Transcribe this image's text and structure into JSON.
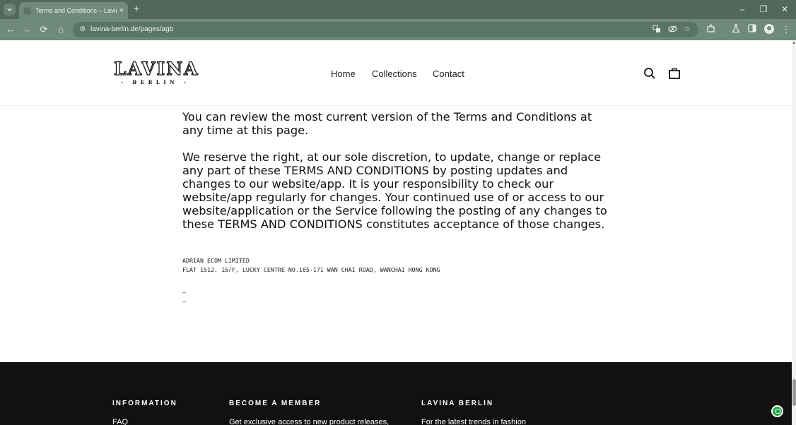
{
  "browser": {
    "tab_title": "Terms and Conditions – Lavina Berlin",
    "tab_close": "×",
    "new_tab": "+",
    "url": "lavina-berlin.de/pages/agb",
    "window_controls": {
      "minimize": "–",
      "restore": "❐",
      "close": "✕"
    },
    "toolbar_glyphs": {
      "back": "←",
      "forward": "→",
      "reload": "⟳",
      "home": "⌂",
      "site_info": "⚙",
      "bookmark": "☆",
      "menu": "⋮"
    }
  },
  "site": {
    "logo_main": "LAVINA",
    "logo_sub": "- BERLIN -",
    "nav": {
      "home": "Home",
      "collections": "Collections",
      "contact": "Contact"
    }
  },
  "content": {
    "paragraphs": [
      "You can review the most current version of the Terms and Conditions at any time at this page.",
      "We reserve the right, at our sole discretion, to update, change or replace any part of these TERMS AND CONDITIONS by posting updates and changes to our website/app. It is your responsibility to check our website/app regularly for changes. Your continued use of or access to our website/application or the Service following the posting of any changes to these TERMS AND CONDITIONS constitutes acceptance of those changes."
    ],
    "company_name": "ADRIAN ECOM LIMITED",
    "company_address": "FLAT 1512. 15/F, LUCKY CENTRE NO.165-171 WAN CHAI ROAD, WANCHAI HONG KONG",
    "dash_1": "–",
    "dash_2": "–"
  },
  "footer": {
    "col1_heading": "INFORMATION",
    "col1_link": "FAQ",
    "col2_heading": "BECOME A MEMBER",
    "col2_text": "Get exclusive access to new product releases,",
    "col3_heading": "LAVINA BERLIN",
    "col3_text": "For the latest trends in fashion"
  },
  "icons": {
    "tab_search": "chevron-down-icon",
    "translate": "translate-icon",
    "eye_off": "eye-off-icon",
    "extensions": "puzzle-icon",
    "labs": "flask-icon",
    "side_panel": "side-panel-icon",
    "profile": "avatar-icon",
    "search": "search-icon",
    "cart": "bag-icon",
    "chat": "chat-icon"
  },
  "colors": {
    "chrome_tabbar": "#51695a",
    "chrome_toolbar": "#6f8a7a",
    "footer_bg": "#111111",
    "chat_green": "#25a244"
  }
}
